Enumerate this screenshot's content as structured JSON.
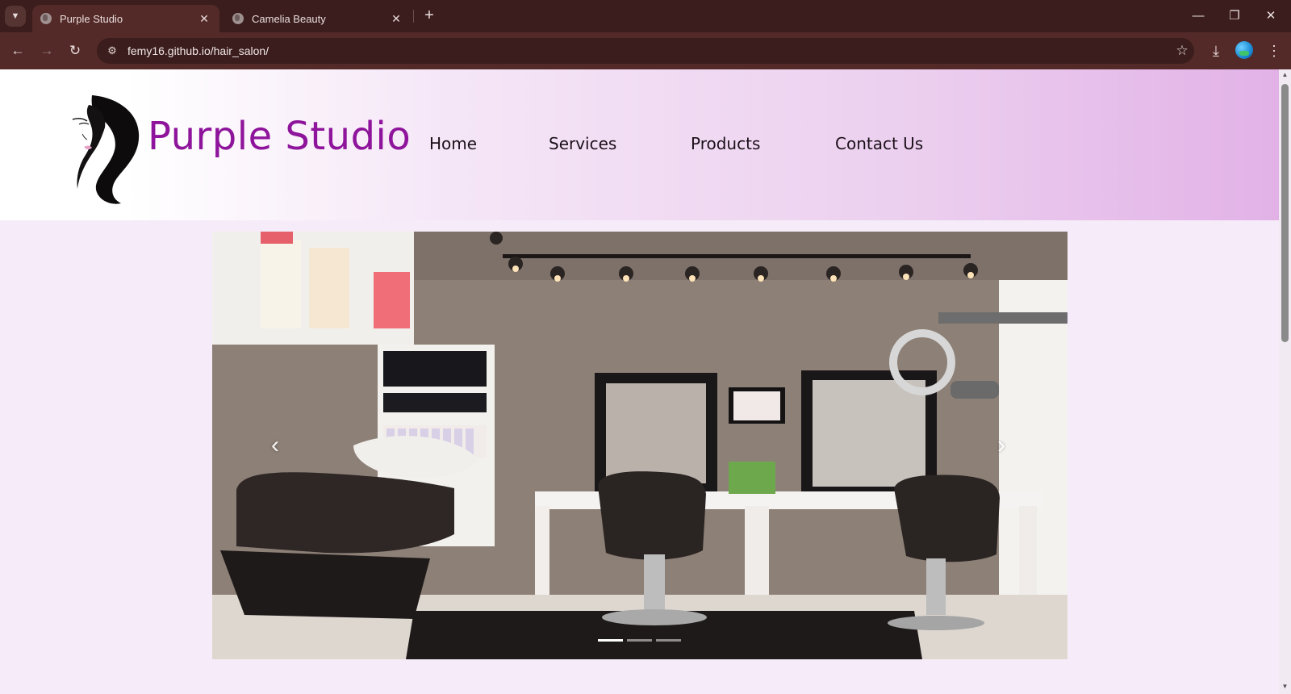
{
  "browser": {
    "tabs": [
      {
        "title": "Purple Studio",
        "active": true
      },
      {
        "title": "Camelia Beauty",
        "active": false
      }
    ],
    "url": "femy16.github.io/hair_salon/",
    "icons": {
      "tab_search": "chevron-down-icon",
      "tab_close": "close-icon",
      "new_tab": "plus-icon",
      "minimize": "minimize-icon",
      "restore": "restore-icon",
      "window_close": "close-icon",
      "back": "arrow-left-icon",
      "forward": "arrow-right-icon",
      "reload": "reload-icon",
      "site_info": "tune-icon",
      "bookmark": "star-icon",
      "downloads": "download-icon",
      "menu": "more-vertical-icon"
    }
  },
  "site": {
    "brand": "Purple Studio",
    "nav": [
      {
        "label": "Home"
      },
      {
        "label": "Services"
      },
      {
        "label": "Products"
      },
      {
        "label": "Contact Us"
      }
    ],
    "colors": {
      "brand": "#8e159b",
      "page_bg": "#f6ecf9",
      "header_gradient_end": "#e2b2e7"
    },
    "carousel": {
      "slide_count": 3,
      "active_slide": 1,
      "icons": {
        "prev": "chevron-left-icon",
        "next": "chevron-right-icon"
      }
    }
  }
}
